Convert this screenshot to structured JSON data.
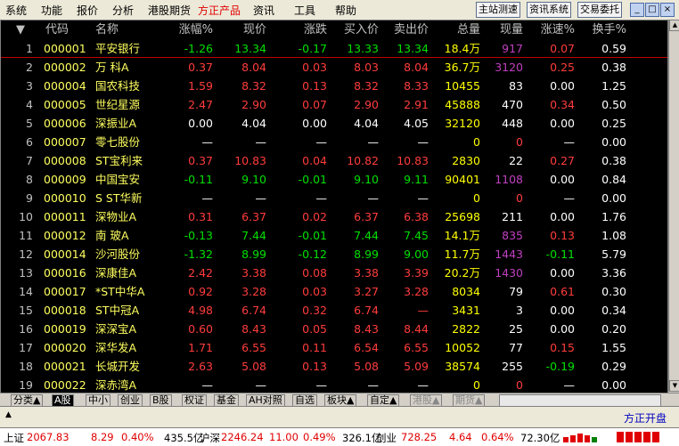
{
  "menu": {
    "items": [
      "系统",
      "功能",
      "报价",
      "分析",
      "港股期货",
      "方正产品",
      "资讯",
      "工具",
      "帮助"
    ],
    "active_index": 5,
    "right_buttons": [
      "主站测速",
      "资讯系统",
      "交易委托"
    ],
    "win_buttons": [
      "_",
      "□",
      "×"
    ]
  },
  "table": {
    "headers": [
      "代码",
      "名称",
      "涨幅%",
      "现价",
      "涨跌",
      "买入价",
      "卖出价",
      "总量",
      "现量",
      "涨速%",
      "换手%"
    ],
    "rows": [
      {
        "n": "1",
        "code": "000001",
        "name": "平安银行",
        "pct": "-1.26",
        "price": "13.34",
        "chg": "-0.17",
        "bid": "13.33",
        "ask": "13.34",
        "vol": "18.4万",
        "cur": "917",
        "spd": "0.07",
        "turn": "0.59"
      },
      {
        "n": "2",
        "code": "000002",
        "name": "万  科A",
        "pct": "0.37",
        "price": "8.04",
        "chg": "0.03",
        "bid": "8.03",
        "ask": "8.04",
        "vol": "36.7万",
        "cur": "3120",
        "spd": "0.25",
        "turn": "0.38"
      },
      {
        "n": "3",
        "code": "000004",
        "name": "国农科技",
        "pct": "1.59",
        "price": "8.32",
        "chg": "0.13",
        "bid": "8.32",
        "ask": "8.33",
        "vol": "10455",
        "cur": "83",
        "spd": "0.00",
        "turn": "1.25"
      },
      {
        "n": "4",
        "code": "000005",
        "name": "世纪星源",
        "pct": "2.47",
        "price": "2.90",
        "chg": "0.07",
        "bid": "2.90",
        "ask": "2.91",
        "vol": "45888",
        "cur": "470",
        "spd": "0.34",
        "turn": "0.50"
      },
      {
        "n": "5",
        "code": "000006",
        "name": "深振业A",
        "pct": "0.00",
        "price": "4.04",
        "chg": "0.00",
        "bid": "4.04",
        "ask": "4.05",
        "vol": "32120",
        "cur": "448",
        "spd": "0.00",
        "turn": "0.25"
      },
      {
        "n": "6",
        "code": "000007",
        "name": "零七股份",
        "pct": "—",
        "price": "—",
        "chg": "—",
        "bid": "—",
        "ask": "—",
        "vol": "0",
        "cur": "0",
        "spd": "—",
        "turn": "0.00"
      },
      {
        "n": "7",
        "code": "000008",
        "name": "ST宝利来",
        "pct": "0.37",
        "price": "10.83",
        "chg": "0.04",
        "bid": "10.82",
        "ask": "10.83",
        "vol": "2830",
        "cur": "22",
        "spd": "0.27",
        "turn": "0.38"
      },
      {
        "n": "8",
        "code": "000009",
        "name": "中国宝安",
        "pct": "-0.11",
        "price": "9.10",
        "chg": "-0.01",
        "bid": "9.10",
        "ask": "9.11",
        "vol": "90401",
        "cur": "1108",
        "spd": "0.00",
        "turn": "0.84"
      },
      {
        "n": "9",
        "code": "000010",
        "name": "S ST华新",
        "pct": "—",
        "price": "—",
        "chg": "—",
        "bid": "—",
        "ask": "—",
        "vol": "0",
        "cur": "0",
        "spd": "—",
        "turn": "0.00"
      },
      {
        "n": "10",
        "code": "000011",
        "name": "深物业A",
        "pct": "0.31",
        "price": "6.37",
        "chg": "0.02",
        "bid": "6.37",
        "ask": "6.38",
        "vol": "25698",
        "cur": "211",
        "spd": "0.00",
        "turn": "1.76"
      },
      {
        "n": "11",
        "code": "000012",
        "name": "南  玻A",
        "pct": "-0.13",
        "price": "7.44",
        "chg": "-0.01",
        "bid": "7.44",
        "ask": "7.45",
        "vol": "14.1万",
        "cur": "835",
        "spd": "0.13",
        "turn": "1.08"
      },
      {
        "n": "12",
        "code": "000014",
        "name": "沙河股份",
        "pct": "-1.32",
        "price": "8.99",
        "chg": "-0.12",
        "bid": "8.99",
        "ask": "9.00",
        "vol": "11.7万",
        "cur": "1443",
        "spd": "-0.11",
        "turn": "5.79"
      },
      {
        "n": "13",
        "code": "000016",
        "name": "深康佳A",
        "pct": "2.42",
        "price": "3.38",
        "chg": "0.08",
        "bid": "3.38",
        "ask": "3.39",
        "vol": "20.2万",
        "cur": "1430",
        "spd": "0.00",
        "turn": "3.36"
      },
      {
        "n": "14",
        "code": "000017",
        "name": "*ST中华A",
        "pct": "0.92",
        "price": "3.28",
        "chg": "0.03",
        "bid": "3.27",
        "ask": "3.28",
        "vol": "8034",
        "cur": "79",
        "spd": "0.61",
        "turn": "0.30"
      },
      {
        "n": "15",
        "code": "000018",
        "name": "ST中冠A",
        "pct": "4.98",
        "price": "6.74",
        "chg": "0.32",
        "bid": "6.74",
        "ask": "—",
        "vol": "3431",
        "cur": "3",
        "spd": "0.00",
        "turn": "0.34"
      },
      {
        "n": "16",
        "code": "000019",
        "name": "深深宝A",
        "pct": "0.60",
        "price": "8.43",
        "chg": "0.05",
        "bid": "8.43",
        "ask": "8.44",
        "vol": "2822",
        "cur": "25",
        "spd": "0.00",
        "turn": "0.20"
      },
      {
        "n": "17",
        "code": "000020",
        "name": "深华发A",
        "pct": "1.71",
        "price": "6.55",
        "chg": "0.11",
        "bid": "6.54",
        "ask": "6.55",
        "vol": "10052",
        "cur": "77",
        "spd": "0.15",
        "turn": "1.55"
      },
      {
        "n": "18",
        "code": "000021",
        "name": "长城开发",
        "pct": "2.63",
        "price": "5.08",
        "chg": "0.13",
        "bid": "5.08",
        "ask": "5.09",
        "vol": "38574",
        "cur": "255",
        "spd": "-0.19",
        "turn": "0.29"
      },
      {
        "n": "19",
        "code": "000022",
        "name": "深赤湾A",
        "pct": "—",
        "price": "—",
        "chg": "—",
        "bid": "—",
        "ask": "—",
        "vol": "0",
        "cur": "0",
        "spd": "—",
        "turn": "0.00"
      }
    ]
  },
  "tabs": [
    "分类▲",
    "A股",
    "中小",
    "创业",
    "B股",
    "权证",
    "基金",
    "AH对照",
    "自选",
    "板块▲",
    "自定▲",
    "港股▲",
    "期货▲"
  ],
  "active_tab": 1,
  "status": {
    "right_text": "方正开盘"
  },
  "ticker": {
    "sh_label": "上证",
    "sh_value": "2067.83",
    "sh_chg": "8.29",
    "sh_pct": "0.40%",
    "sh_amt": "435.5亿",
    "sz_label": "沪深",
    "sz_value": "2246.24",
    "sz_chg": "11.00",
    "sz_pct": "0.49%",
    "sz_amt": "326.1亿",
    "cy_label": "创业",
    "cy_value": "728.25",
    "cy_chg": "4.64",
    "cy_pct": "0.64%",
    "cy_amt": "72.30亿"
  },
  "colors": {
    "up": "#ff3c3c",
    "down": "#00e000",
    "flat": "#ffffff",
    "vol": "#ffff00",
    "cur_hi": "#c040c0",
    "code": "#ffff60",
    "name": "#ffff60"
  }
}
